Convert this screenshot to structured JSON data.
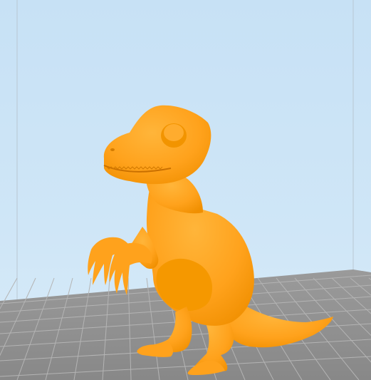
{
  "viewport": {
    "background_color": "#cfe6f7",
    "plate_color": "#8f8f8f",
    "plate_grid_color": "#b4b4b4",
    "model_color": "#ffa21c",
    "model_shadow_color": "#e98a00",
    "model_highlight_color": "#ffbb4a",
    "model_name": "raptor-model"
  }
}
